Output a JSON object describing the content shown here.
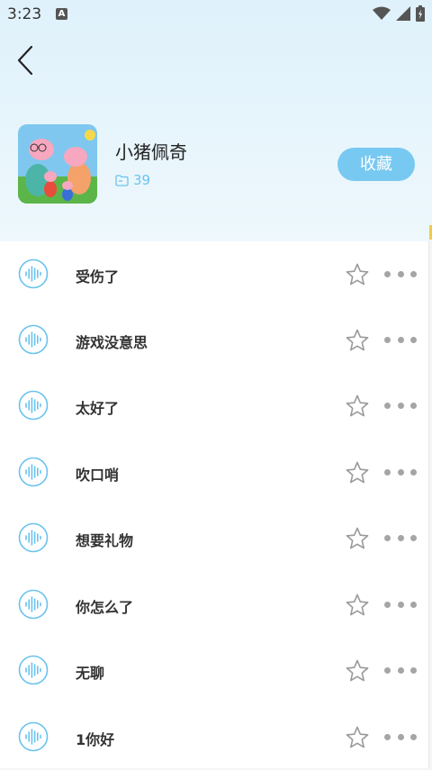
{
  "status_bar": {
    "time": "3:23",
    "notification_letter": "A"
  },
  "album": {
    "title": "小猪佩奇",
    "track_count": "39",
    "favorite_label": "收藏"
  },
  "tracks": [
    {
      "title": "受伤了"
    },
    {
      "title": "游戏没意思"
    },
    {
      "title": "太好了"
    },
    {
      "title": "吹口哨"
    },
    {
      "title": "想要礼物"
    },
    {
      "title": "你怎么了"
    },
    {
      "title": "无聊"
    },
    {
      "title": "1你好"
    }
  ],
  "colors": {
    "accent": "#78c9f1",
    "icon_blue": "#6ac3ee",
    "text_dark": "#333333"
  }
}
